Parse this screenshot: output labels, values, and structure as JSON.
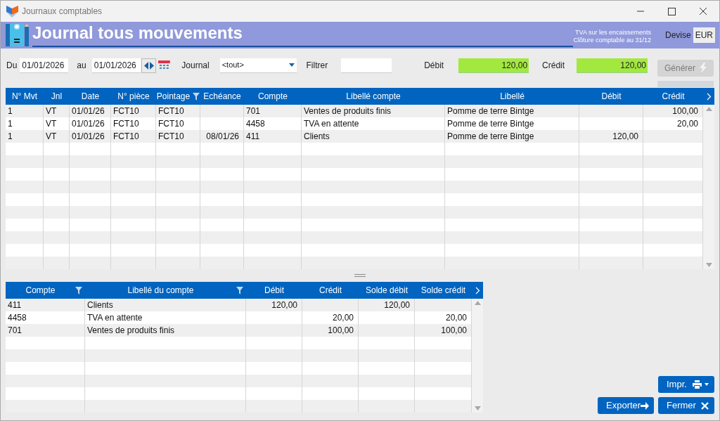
{
  "window": {
    "title": "Journaux comptables"
  },
  "header": {
    "title": "Journal tous mouvements",
    "info_lines": [
      "TVA sur les encaissements",
      "Clôture comptable au 31/12"
    ],
    "currency_label": "Devise",
    "currency": "EUR"
  },
  "filters": {
    "from_label": "Du",
    "from": "01/01/2026",
    "to_label": "au",
    "to": "01/01/2026",
    "journal_label": "Journal",
    "journal": "<tout>",
    "filter_label": "Filtrer",
    "debit_label": "Débit",
    "debit": "120,00",
    "credit_label": "Crédit",
    "credit": "120,00",
    "generate": {
      "label": "Générer",
      "disabled": true
    }
  },
  "movements": {
    "columns": [
      {
        "label": "N° Mvt",
        "kind": "text",
        "filter": false
      },
      {
        "label": "Jnl",
        "kind": "text",
        "filter": false
      },
      {
        "label": "Date",
        "kind": "text",
        "filter": false
      },
      {
        "label": "N° pièce",
        "kind": "text",
        "filter": false
      },
      {
        "label": "Pointage",
        "kind": "text",
        "filter": true
      },
      {
        "label": "Echéance",
        "kind": "number",
        "filter": false
      },
      {
        "label": "Compte",
        "kind": "text",
        "filter": false
      },
      {
        "label": "Libellé compte",
        "kind": "text",
        "filter": false
      },
      {
        "label": "Libellé",
        "kind": "text",
        "filter": false
      },
      {
        "label": "Débit",
        "kind": "number",
        "filter": false
      },
      {
        "label": "Crédit",
        "kind": "number",
        "filter": false
      }
    ],
    "rows": [
      [
        "1",
        "VT",
        "01/01/26",
        "FCT10",
        "FCT10",
        "",
        "701",
        "Ventes de produits finis",
        "Pomme de terre Bintge",
        "",
        "100,00"
      ],
      [
        "1",
        "VT",
        "01/01/26",
        "FCT10",
        "FCT10",
        "",
        "4458",
        "TVA en attente",
        "Pomme de terre Bintge",
        "",
        "20,00"
      ],
      [
        "1",
        "VT",
        "01/01/26",
        "FCT10",
        "FCT10",
        "08/01/26",
        "411",
        "Clients",
        "Pomme de terre Bintge",
        "120,00",
        ""
      ]
    ]
  },
  "balances": {
    "columns": [
      {
        "label": "Compte",
        "kind": "text",
        "filter": true
      },
      {
        "label": "Libellé du compte",
        "kind": "text",
        "filter": true
      },
      {
        "label": "Débit",
        "kind": "number",
        "filter": false
      },
      {
        "label": "Crédit",
        "kind": "number",
        "filter": false
      },
      {
        "label": "Solde débit",
        "kind": "number",
        "filter": false
      },
      {
        "label": "Solde crédit",
        "kind": "number",
        "filter": false
      }
    ],
    "rows": [
      [
        "411",
        "Clients",
        "120,00",
        "",
        "120,00",
        ""
      ],
      [
        "4458",
        "TVA en attente",
        "",
        "20,00",
        "",
        "20,00"
      ],
      [
        "701",
        "Ventes de produits finis",
        "",
        "100,00",
        "",
        "100,00"
      ]
    ]
  },
  "buttons": [
    {
      "label": "Impr.",
      "kind": "print"
    },
    {
      "label": "Exporter",
      "kind": "export"
    },
    {
      "label": "Fermer",
      "kind": "close"
    }
  ]
}
